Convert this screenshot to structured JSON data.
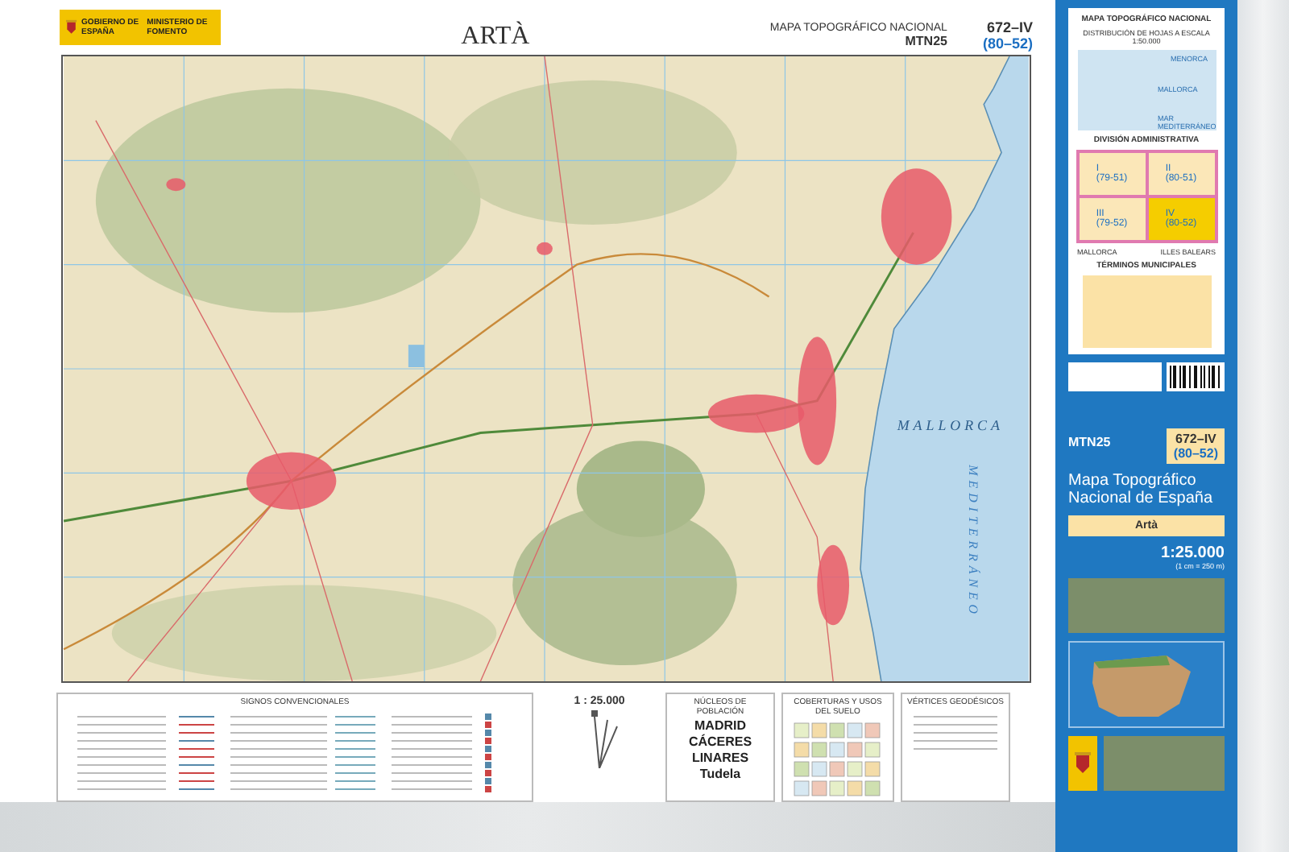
{
  "header": {
    "logo": {
      "line_1": "GOBIERNO DE ESPAÑA",
      "line_2": "MINISTERIO DE FOMENTO"
    },
    "title": "ARTÀ",
    "series": "MAPA TOPOGRÁFICO NACIONAL",
    "series_code": "MTN25",
    "sheet": "672–IV",
    "sheet_grid": "(80–52)"
  },
  "map": {
    "labels": [
      {
        "kind": "horizontal",
        "text": "MALLORCA"
      },
      {
        "kind": "vertical",
        "text": "MEDITERRÁNEO"
      }
    ]
  },
  "legend": {
    "signs_title": "SIGNOS CONVENCIONALES",
    "scale": "1 : 25.000",
    "population_title": "NÚCLEOS DE POBLACIÓN",
    "population_examples": [
      "MADRID",
      "CÁCERES",
      "LINARES",
      "Tudela"
    ],
    "land_cover_title": "COBERTURAS Y USOS DEL SUELO",
    "vertices_title": "VÉRTICES GEODÉSICOS"
  },
  "side_panel": {
    "index_title": "MAPA TOPOGRÁFICO NACIONAL",
    "index_subtitle": "DISTRIBUCIÓN DE HOJAS A ESCALA 1:50.000",
    "index_labels": [
      "MENORCA",
      "MALLORCA",
      "MAR MEDITERRÁNEO"
    ],
    "division_title": "DIVISIÓN ADMINISTRATIVA",
    "division_cells": [
      {
        "label": "I",
        "code": "(79-51)",
        "selected": false
      },
      {
        "label": "II",
        "code": "(80-51)",
        "selected": false
      },
      {
        "label": "III",
        "code": "(79-52)",
        "selected": false
      },
      {
        "label": "IV",
        "code": "(80-52)",
        "selected": true
      }
    ],
    "division_labels": [
      "MALLORCA",
      "ILLES BALEARS"
    ],
    "municipalities_title": "TÉRMINOS MUNICIPALES",
    "cover": {
      "series_code": "MTN25",
      "sheet": "672–IV",
      "sheet_grid": "(80–52)",
      "title": "Mapa Topográfico Nacional de España",
      "name": "Artà",
      "scale": "1:25.000",
      "scale_note": "(1 cm = 250 m)"
    }
  }
}
